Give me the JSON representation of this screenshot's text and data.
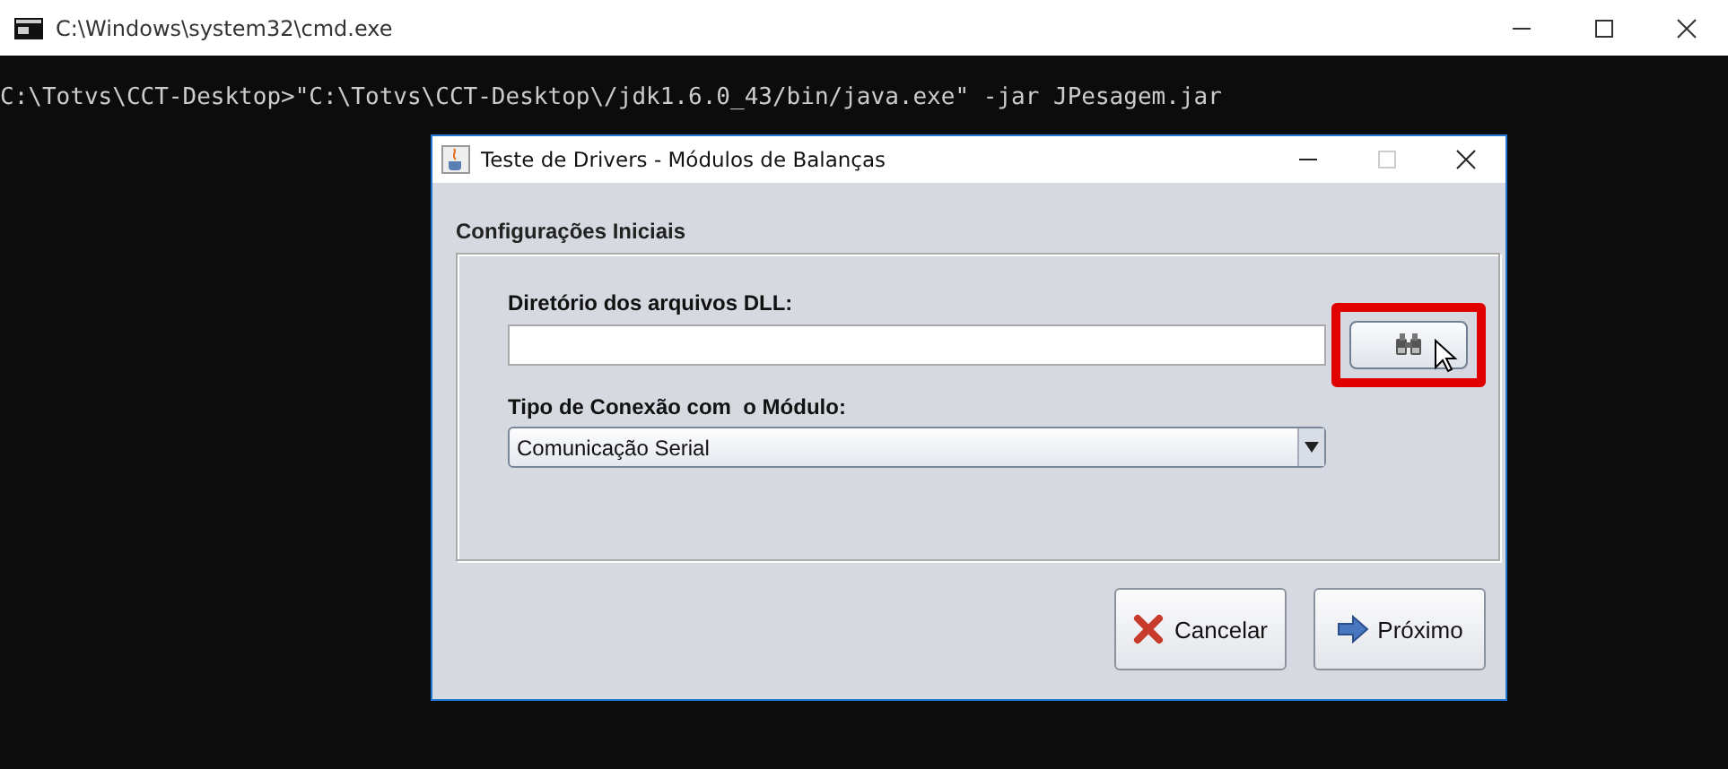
{
  "console_window": {
    "title": "C:\\Windows\\system32\\cmd.exe",
    "lines": [
      "C:\\Totvs\\CCT-Desktop>\"C:\\Totvs\\CCT-Desktop\\/jdk1.6.0_43/bin/java.exe\" -jar JPesagem.jar"
    ]
  },
  "dialog": {
    "title": "Teste de Drivers - Módulos de Balanças",
    "maximize_disabled": true,
    "section_title": "Configurações Iniciais",
    "dll_label": "Diretório dos arquivos DLL:",
    "browse_highlighted": true,
    "connection_label": "Tipo de Conexão com  o Módulo:",
    "connection_value": "Comunicação Serial",
    "buttons": [
      {
        "kind": "cancel",
        "label": "Cancelar"
      },
      {
        "kind": "next",
        "label": "Próximo"
      }
    ]
  }
}
